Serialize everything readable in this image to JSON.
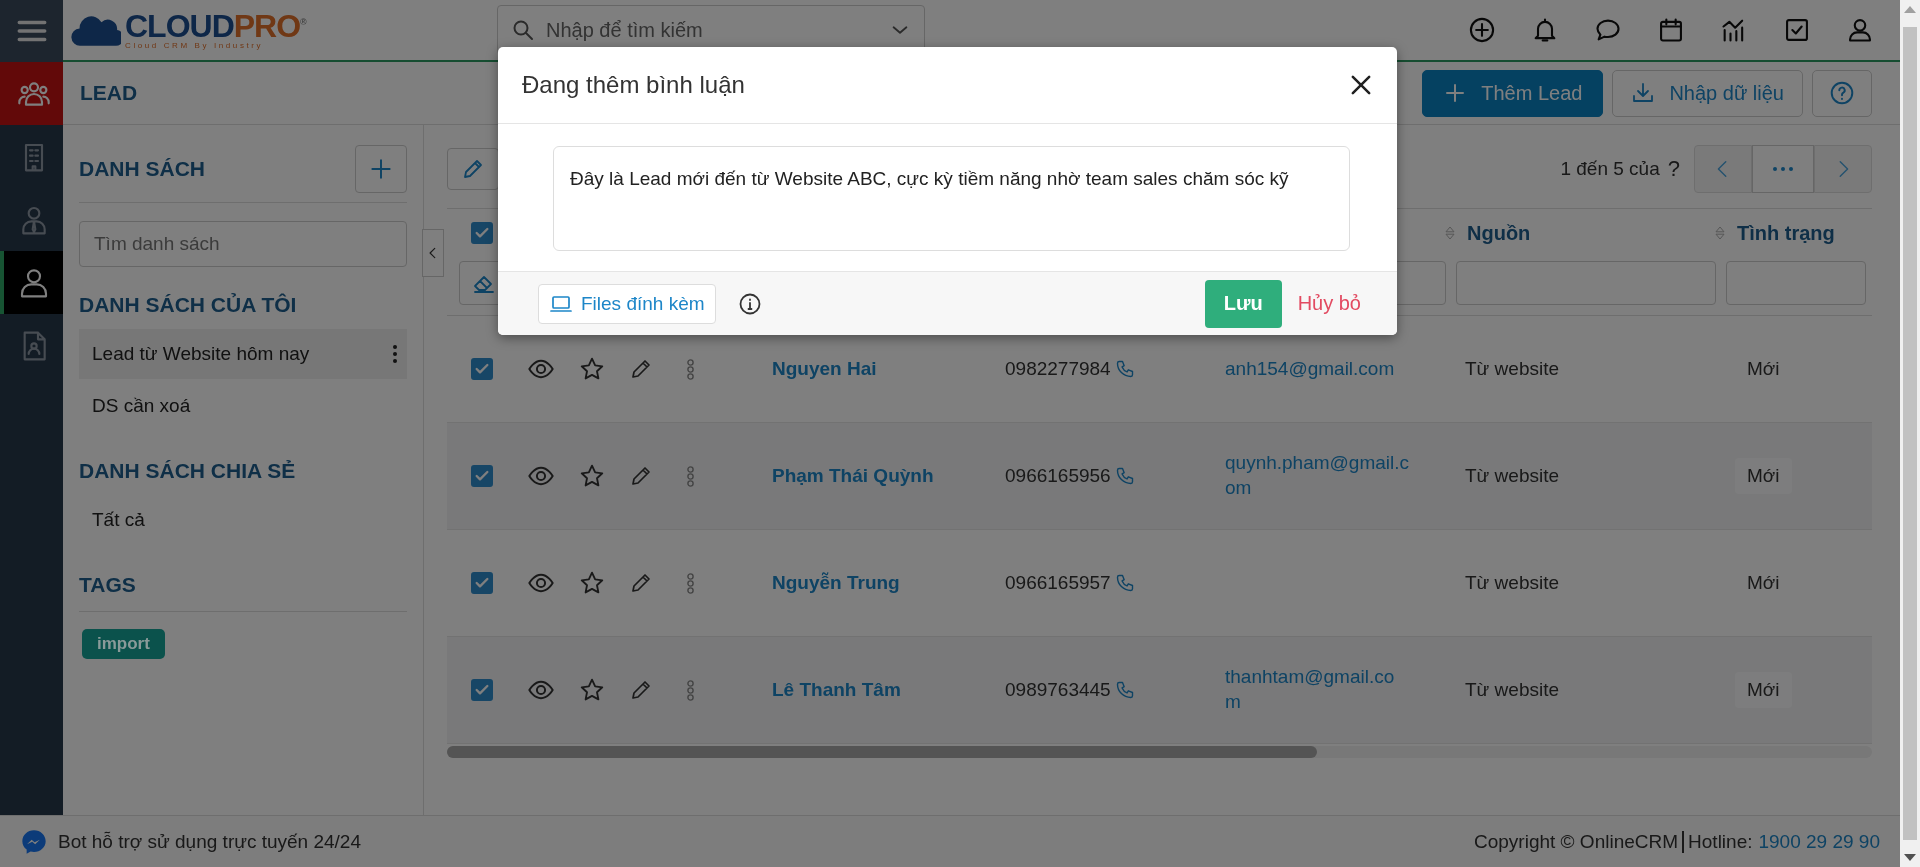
{
  "rail": {
    "items": [
      {
        "selected": false
      },
      {
        "selected": false
      },
      {
        "selected": false
      },
      {
        "selected": true
      },
      {
        "selected": false
      }
    ]
  },
  "logo": {
    "word": "CLOUD",
    "accent": "PRO",
    "mark": "®",
    "tagline": "Cloud CRM By Industry"
  },
  "search": {
    "placeholder": "Nhập để tìm kiếm"
  },
  "page_title": "LEAD",
  "actions": {
    "add_label": "Thêm Lead",
    "import_label": "Nhập dữ liệu"
  },
  "sidebar": {
    "title": "DANH SÁCH",
    "search": {
      "placeholder": "Tìm danh sách"
    },
    "sections": [
      {
        "title": "DANH SÁCH CỦA TÔI",
        "items": [
          {
            "label": "Lead từ Website hôm nay",
            "selected": true
          },
          {
            "label": "DS cần xoá",
            "selected": false
          }
        ]
      },
      {
        "title": "DANH SÁCH CHIA SẺ",
        "items": [
          {
            "label": "Tất cả",
            "selected": false
          }
        ]
      }
    ],
    "tags_title": "TAGS",
    "tags": [
      {
        "label": "import",
        "color": "#0b524c"
      }
    ]
  },
  "pagination": {
    "range": "1 đến 5 của",
    "total": "?"
  },
  "table": {
    "all_checked": true,
    "columns": [
      {
        "label": "Nguồn"
      },
      {
        "label": "Tình trạng"
      }
    ],
    "rows": [
      {
        "checked": true,
        "name": "Nguyen Hai",
        "phone": "0982277984",
        "email": "anh154@gmail.com",
        "source": "Từ website",
        "status": "Mới"
      },
      {
        "checked": true,
        "name": "Phạm Thái Quỳnh",
        "phone": "0966165956",
        "email": "quynh.pham@gmail.com",
        "source": "Từ website",
        "status": "Mới"
      },
      {
        "checked": true,
        "name": "Nguyễn Trung",
        "phone": "0966165957",
        "source": "Từ website",
        "status": "Mới"
      },
      {
        "checked": true,
        "name": "Lê Thanh Tâm",
        "phone": "0989763445",
        "email": "thanhtam@gmail.com",
        "source": "Từ website",
        "status": "Mới"
      }
    ]
  },
  "footer": {
    "bot_text": "Bot hỗ trợ sử dụng trực tuyến 24/24",
    "copyright": "Copyright © OnlineCRM",
    "hotline_label": "Hotline:",
    "hotline": "1900 29 29 90"
  },
  "modal": {
    "title": "Đang thêm bình luận",
    "comment": "Đây là Lead mới đến từ Website ABC, cực kỳ tiềm năng nhờ team sales chăm sóc kỹ",
    "attach_label": "Files đính kèm",
    "save_label": "Lưu",
    "cancel_label": "Hủy bỏ"
  }
}
